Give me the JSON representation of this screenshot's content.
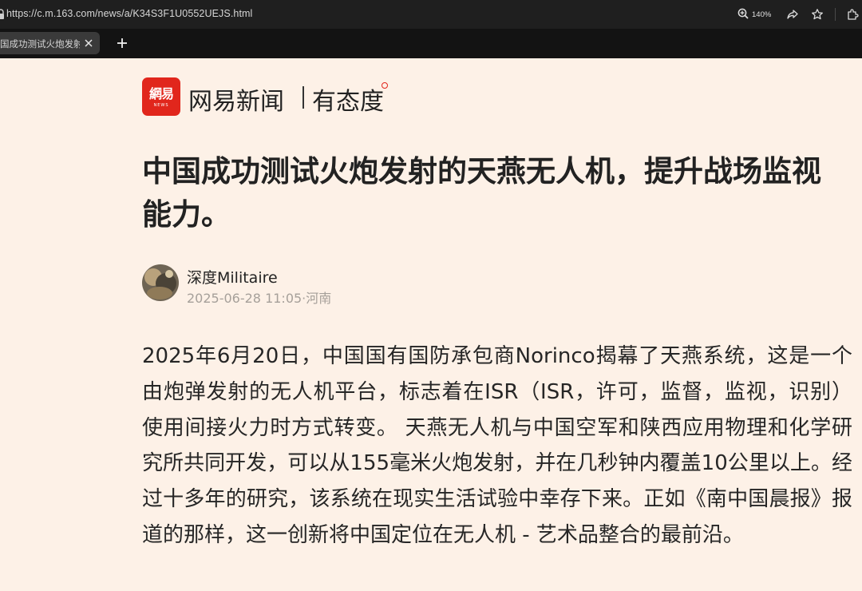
{
  "browser": {
    "url": "https://c.m.163.com/news/a/K34S3F1U0552UEJS.html",
    "zoom_level": "140%",
    "tab_title": "国成功测试火炮发射的天燕无人",
    "new_tab_label": "+"
  },
  "site": {
    "logo_glyph": "網易",
    "logo_sub": "NEWS",
    "brand_name": "网易新闻",
    "slogan": "有态度",
    "brand_color": "#e1261c"
  },
  "article": {
    "title": "中国成功测试火炮发射的天燕无人机，提升战场监视能力。",
    "author": "深度Militaire",
    "meta": "2025-06-28 11:05·河南",
    "body": "2025年6月20日，中国国有国防承包商Norinco揭幕了天燕系统，这是一个由炮弹发射的无人机平台，标志着在ISR（ISR，许可，监督，监视，识别）使用间接火力时方式转变。 天燕无人机与中国空军和陕西应用物理和化学研究所共同开发，可以从155毫米火炮发射，并在几秒钟内覆盖10公里以上。经过十多年的研究，该系统在现实生活试验中幸存下来。正如《南中国晨报》报道的那样，这一创新将中国定位在无人机 - 艺术品整合的最前沿。"
  },
  "icons": {
    "zoom": "zoom-in-icon",
    "share": "share-icon",
    "favorite": "star-icon",
    "extensions": "extensions-icon",
    "close_tab": "close-icon",
    "new_tab": "plus-icon"
  }
}
